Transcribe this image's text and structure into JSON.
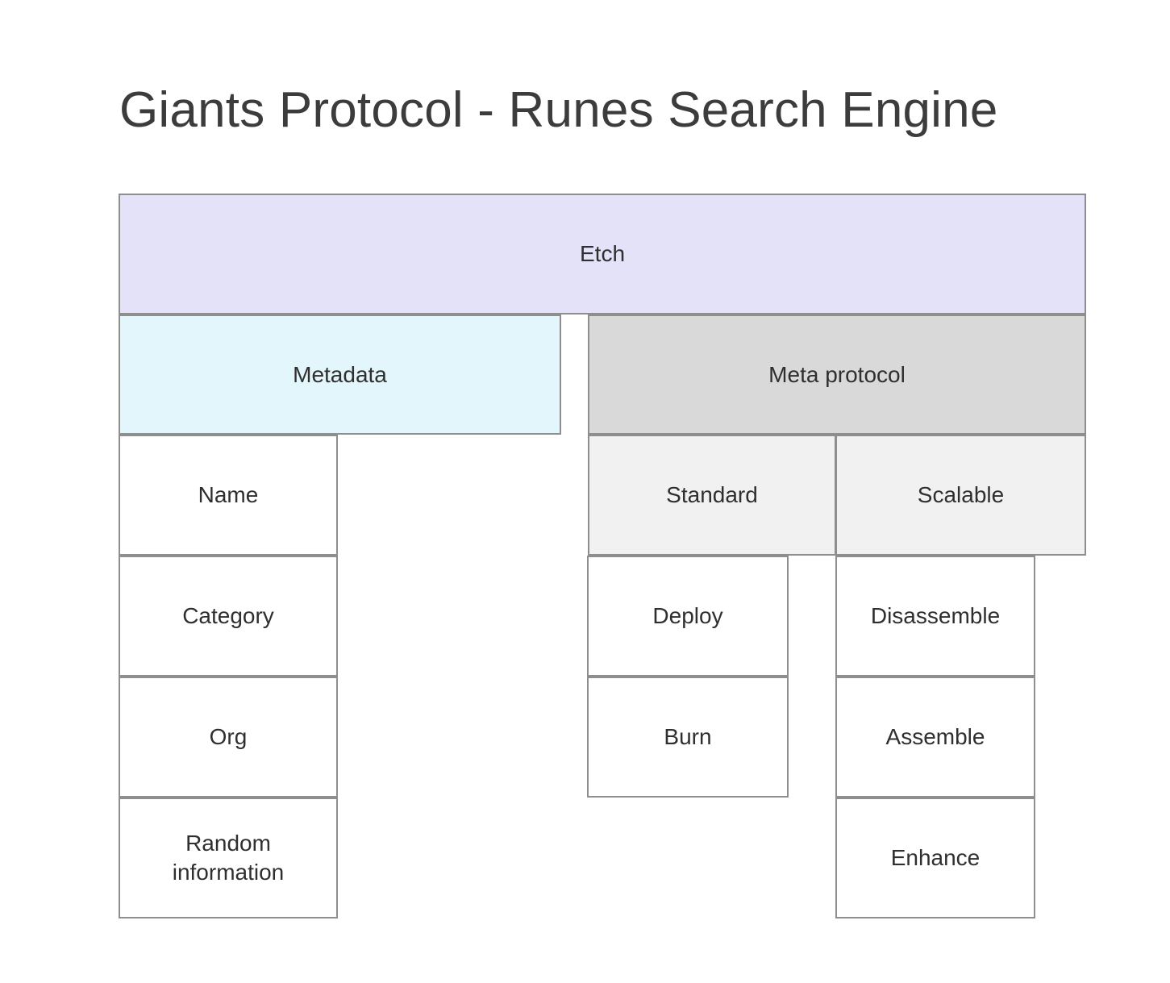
{
  "title": "Giants Protocol - Runes Search Engine",
  "colors": {
    "title_text": "#3c3c3c",
    "node_text": "#2f2f2f",
    "node_border": "#8e8e8e",
    "etch_fill": "#e3e2f8",
    "metadata_fill": "#e3f6fc",
    "meta_protocol_fill": "#d9d9d9",
    "sub_fill": "#f1f1f1",
    "leaf_fill": "#ffffff",
    "page_background": "#ffffff"
  },
  "diagram": {
    "type": "tree",
    "root": {
      "label": "Etch"
    },
    "branches": [
      {
        "label": "Metadata",
        "children": [
          {
            "label": "Name"
          },
          {
            "label": "Category"
          },
          {
            "label": "Org"
          },
          {
            "label": "Random\ninformation"
          }
        ]
      },
      {
        "label": "Meta protocol",
        "subgroups": [
          {
            "label": "Standard",
            "children": [
              {
                "label": "Deploy"
              },
              {
                "label": "Burn"
              }
            ]
          },
          {
            "label": "Scalable",
            "children": [
              {
                "label": "Disassemble"
              },
              {
                "label": "Assemble"
              },
              {
                "label": "Enhance"
              }
            ]
          }
        ]
      }
    ]
  },
  "nodes": {
    "etch": "Etch",
    "metadata": "Metadata",
    "meta_protocol": "Meta protocol",
    "name": "Name",
    "category": "Category",
    "org": "Org",
    "random_information": "Random\ninformation",
    "standard": "Standard",
    "scalable": "Scalable",
    "deploy": "Deploy",
    "burn": "Burn",
    "disassemble": "Disassemble",
    "assemble": "Assemble",
    "enhance": "Enhance"
  }
}
